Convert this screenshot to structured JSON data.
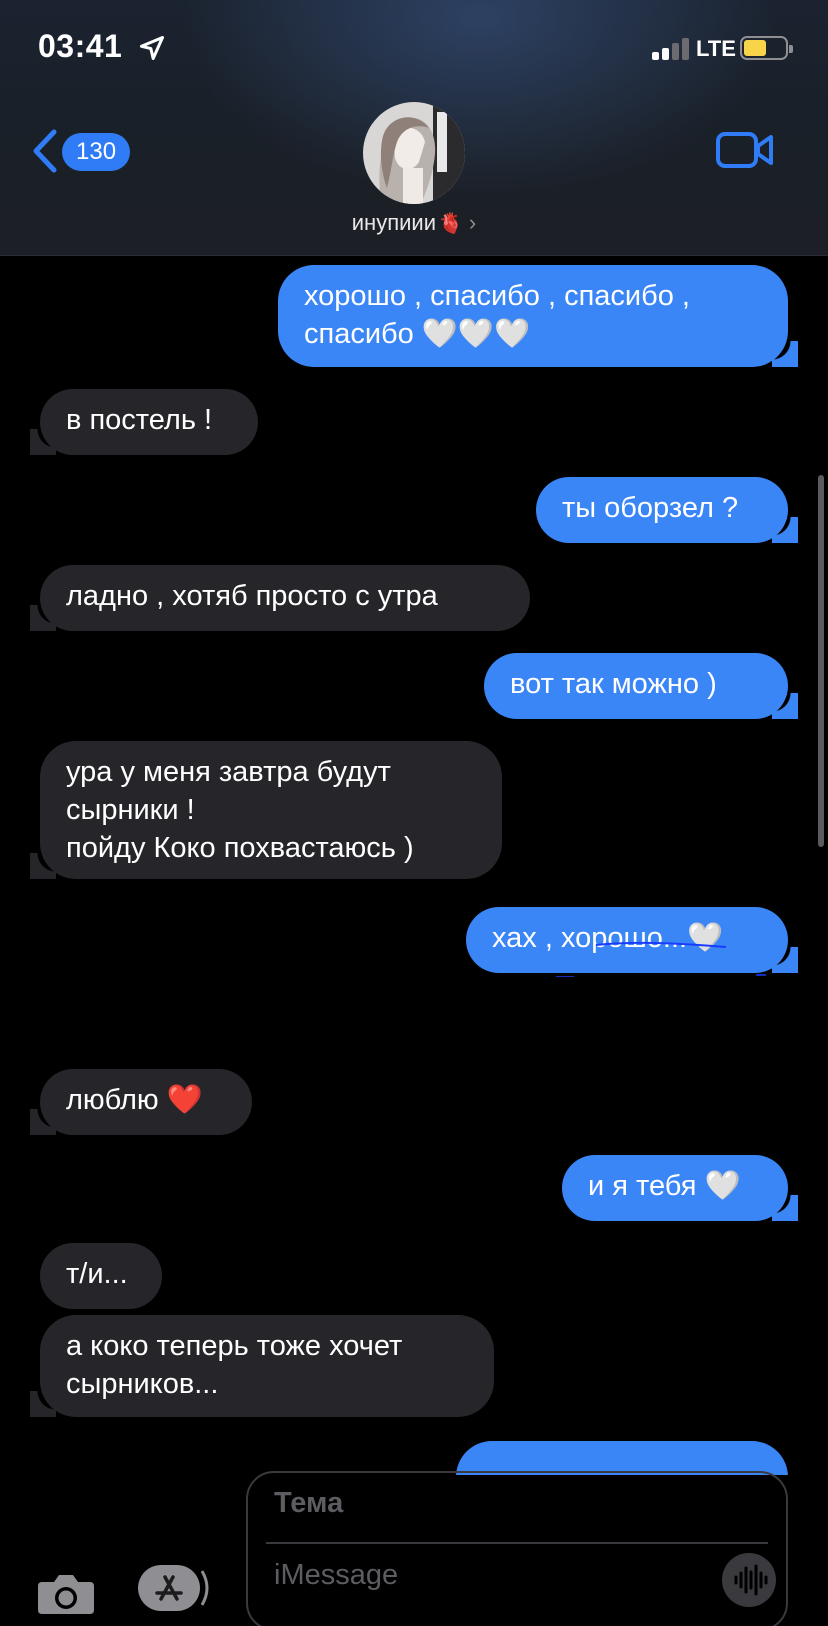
{
  "status_bar": {
    "time": "03:41",
    "network": "LTE",
    "battery_level": 0.45,
    "colors": {
      "battery": "#f8d548"
    }
  },
  "header": {
    "back_count": "130",
    "contact_name": "инупиии",
    "contact_emoji": "🫀",
    "colors": {
      "accent": "#2f7cf6"
    }
  },
  "messages": [
    {
      "direction": "out",
      "lines": [
        "хорошо , спасибо , спасибо ,",
        "спасибо 🤍🤍🤍"
      ]
    },
    {
      "direction": "in",
      "lines": [
        "в постель !"
      ]
    },
    {
      "direction": "out",
      "lines": [
        "ты оборзел ?"
      ]
    },
    {
      "direction": "in",
      "lines": [
        "ладно , хотяб просто с утра"
      ]
    },
    {
      "direction": "out",
      "lines": [
        "вот так можно )"
      ]
    },
    {
      "direction": "in",
      "lines": [
        "ура у меня завтра будут",
        "сырники !",
        "пойду Коко похвастаюсь )"
      ]
    },
    {
      "direction": "out",
      "lines": [
        "хах , хорошо...🤍"
      ]
    },
    {
      "direction": "in",
      "lines": [
        "люблю ❤️"
      ]
    },
    {
      "direction": "out",
      "lines": [
        "и я тебя 🤍"
      ]
    },
    {
      "direction": "in",
      "lines": [
        "т/и..."
      ]
    },
    {
      "direction": "in",
      "lines": [
        "а коко теперь тоже хочет",
        "сырников..."
      ]
    },
    {
      "direction": "out",
      "lines": [
        ""
      ]
    }
  ],
  "composer": {
    "subject_placeholder": "Тема",
    "message_placeholder": "iMessage"
  },
  "bubble_colors": {
    "outgoing": "#3a86f7",
    "incoming": "#26262a"
  }
}
